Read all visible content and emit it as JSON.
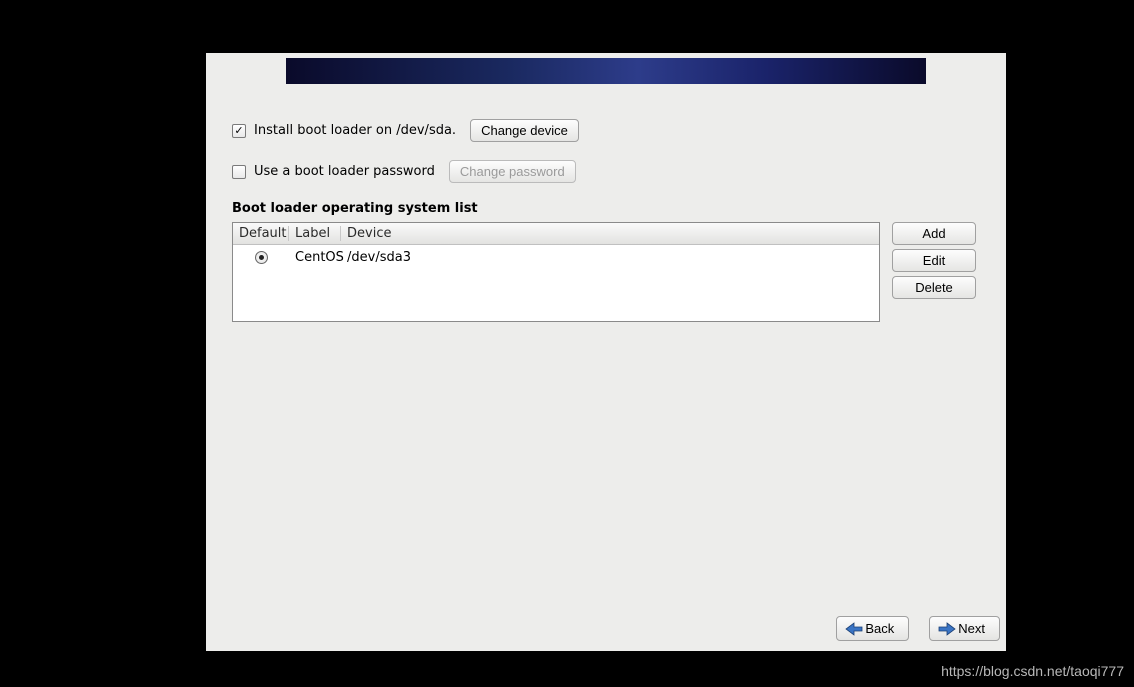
{
  "install_checkbox": {
    "checked": true,
    "label": "Install boot loader on /dev/sda.",
    "change_device_label": "Change device"
  },
  "password_checkbox": {
    "checked": false,
    "label": "Use a boot loader password",
    "change_password_label": "Change password"
  },
  "os_list": {
    "title": "Boot loader operating system list",
    "headers": {
      "default": "Default",
      "label": "Label",
      "device": "Device"
    },
    "rows": [
      {
        "default": true,
        "label": "CentOS",
        "device": "/dev/sda3"
      }
    ]
  },
  "side_buttons": {
    "add": "Add",
    "edit": "Edit",
    "delete": "Delete"
  },
  "nav": {
    "back": "Back",
    "next": "Next"
  },
  "watermark": "https://blog.csdn.net/taoqi777"
}
